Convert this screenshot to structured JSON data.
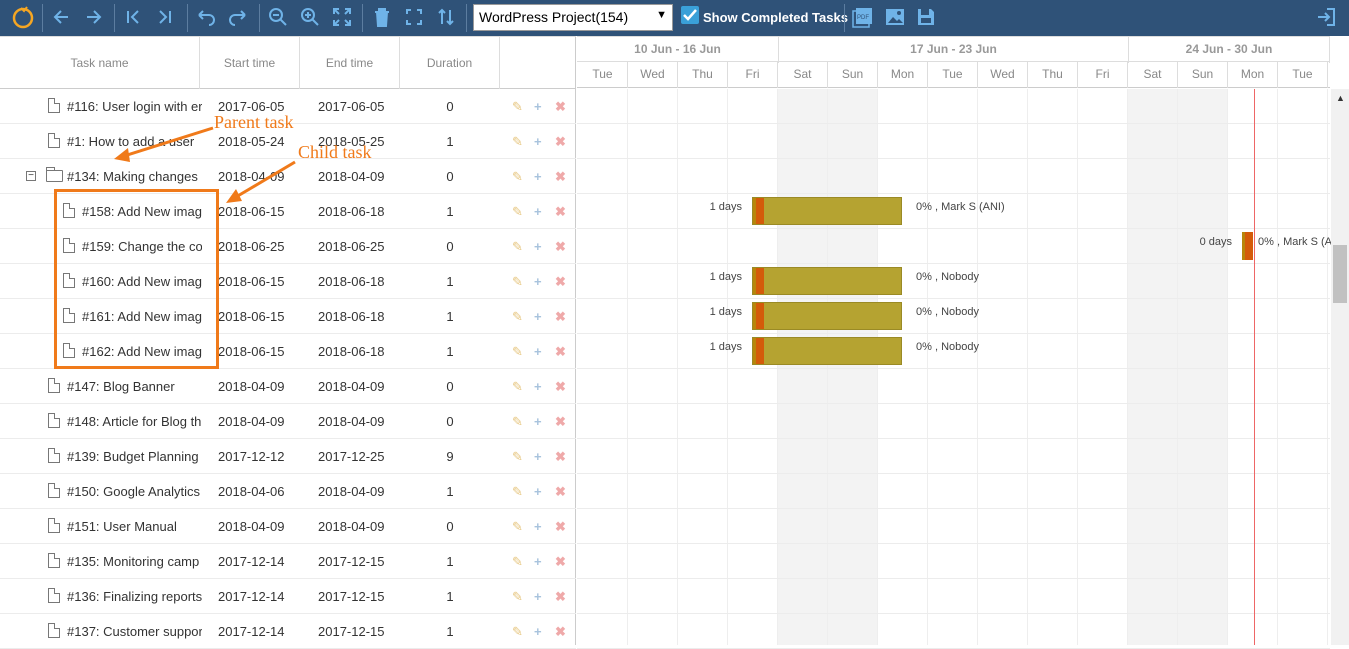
{
  "toolbar": {
    "project_select": "WordPress Project(154)",
    "show_completed_label": "Show Completed Tasks",
    "show_completed_checked": true
  },
  "grid": {
    "headers": [
      "Task name",
      "Start time",
      "End time",
      "Duration"
    ],
    "rows": [
      {
        "name": "#116: User login with er",
        "start": "2017-06-05",
        "end": "2017-06-05",
        "duration": "0",
        "level": 0,
        "type": "task"
      },
      {
        "name": "#1: How to add a user",
        "start": "2018-05-24",
        "end": "2018-05-25",
        "duration": "1",
        "level": 0,
        "type": "task"
      },
      {
        "name": "#134: Making changes",
        "start": "2018-04-09",
        "end": "2018-04-09",
        "duration": "0",
        "level": 0,
        "type": "parent"
      },
      {
        "name": "#158: Add New imag",
        "start": "2018-06-15",
        "end": "2018-06-18",
        "duration": "1",
        "level": 1,
        "type": "task"
      },
      {
        "name": "#159: Change the co",
        "start": "2018-06-25",
        "end": "2018-06-25",
        "duration": "0",
        "level": 1,
        "type": "task"
      },
      {
        "name": "#160: Add New imag",
        "start": "2018-06-15",
        "end": "2018-06-18",
        "duration": "1",
        "level": 1,
        "type": "task"
      },
      {
        "name": "#161: Add New imag",
        "start": "2018-06-15",
        "end": "2018-06-18",
        "duration": "1",
        "level": 1,
        "type": "task"
      },
      {
        "name": "#162: Add New imag",
        "start": "2018-06-15",
        "end": "2018-06-18",
        "duration": "1",
        "level": 1,
        "type": "task"
      },
      {
        "name": "#147: Blog Banner",
        "start": "2018-04-09",
        "end": "2018-04-09",
        "duration": "0",
        "level": 0,
        "type": "task"
      },
      {
        "name": "#148: Article for Blog th",
        "start": "2018-04-09",
        "end": "2018-04-09",
        "duration": "0",
        "level": 0,
        "type": "task"
      },
      {
        "name": "#139: Budget Planning",
        "start": "2017-12-12",
        "end": "2017-12-25",
        "duration": "9",
        "level": 0,
        "type": "task"
      },
      {
        "name": "#150: Google Analytics",
        "start": "2018-04-06",
        "end": "2018-04-09",
        "duration": "1",
        "level": 0,
        "type": "task"
      },
      {
        "name": "#151: User Manual",
        "start": "2018-04-09",
        "end": "2018-04-09",
        "duration": "0",
        "level": 0,
        "type": "task"
      },
      {
        "name": "#135: Monitoring camp",
        "start": "2017-12-14",
        "end": "2017-12-15",
        "duration": "1",
        "level": 0,
        "type": "task"
      },
      {
        "name": "#136: Finalizing reports",
        "start": "2017-12-14",
        "end": "2017-12-15",
        "duration": "1",
        "level": 0,
        "type": "task"
      },
      {
        "name": "#137: Customer suppor",
        "start": "2017-12-14",
        "end": "2017-12-15",
        "duration": "1",
        "level": 0,
        "type": "task"
      }
    ]
  },
  "timeline": {
    "weeks": [
      "10 Jun - 16 Jun",
      "17 Jun - 23 Jun",
      "24 Jun - 30 Jun"
    ],
    "days": [
      "Tue",
      "Wed",
      "Thu",
      "Fri",
      "Sat",
      "Sun",
      "Mon",
      "Tue",
      "Wed",
      "Thu",
      "Fri",
      "Sat",
      "Sun",
      "Mon",
      "Tue"
    ],
    "bars": [
      {
        "row": 3,
        "left_label": "1 days",
        "right_label": "0% , Mark S (ANI)",
        "start_day": 3.5,
        "length_days": 3
      },
      {
        "row": 4,
        "left_label": "0 days",
        "right_label": "0% , Mark S (A",
        "start_day": 13.3,
        "length_days": 0,
        "milestone": true
      },
      {
        "row": 5,
        "left_label": "1 days",
        "right_label": "0% , Nobody",
        "start_day": 3.5,
        "length_days": 3
      },
      {
        "row": 6,
        "left_label": "1 days",
        "right_label": "0% , Nobody",
        "start_day": 3.5,
        "length_days": 3
      },
      {
        "row": 7,
        "left_label": "1 days",
        "right_label": "0% , Nobody",
        "start_day": 3.5,
        "length_days": 3
      }
    ]
  },
  "annotations": {
    "parent_label": "Parent task",
    "child_label": "Child task"
  },
  "colors": {
    "toolbar_bg": "#2f5278",
    "bar_fill": "#b5a331",
    "progress_fill": "#d45b0a",
    "annotation": "#f07a1a",
    "today_line": "#e66666"
  }
}
